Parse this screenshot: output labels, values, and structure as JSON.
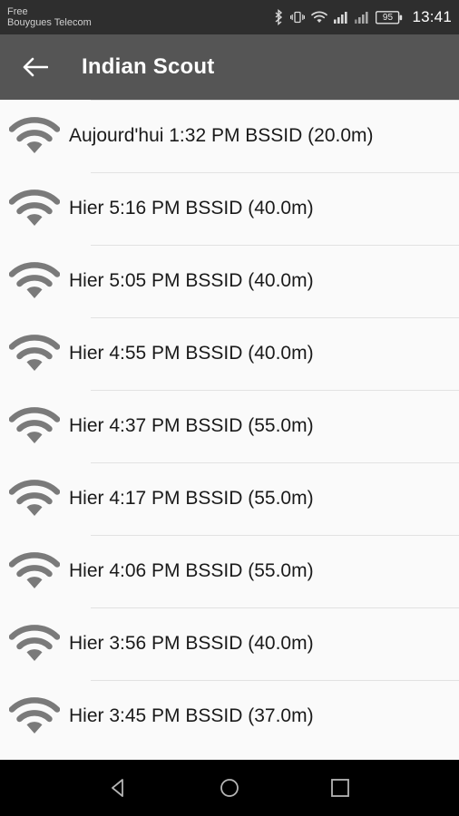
{
  "status_bar": {
    "carriers": [
      "Free",
      "Bouygues Telecom"
    ],
    "icons": [
      "bluetooth-icon",
      "vibrate-icon",
      "wifi-icon",
      "signal-1-icon",
      "signal-2-icon",
      "battery-icon"
    ],
    "battery_level": "95",
    "clock": "13:41"
  },
  "toolbar": {
    "back_icon": "back-arrow-icon",
    "title": "Indian Scout"
  },
  "list": {
    "items": [
      {
        "icon": "wifi-icon",
        "label": "Aujourd'hui 1:32 PM BSSID (20.0m)"
      },
      {
        "icon": "wifi-icon",
        "label": "Hier 5:16 PM BSSID (40.0m)"
      },
      {
        "icon": "wifi-icon",
        "label": "Hier 5:05 PM BSSID (40.0m)"
      },
      {
        "icon": "wifi-icon",
        "label": "Hier 4:55 PM BSSID (40.0m)"
      },
      {
        "icon": "wifi-icon",
        "label": "Hier 4:37 PM BSSID (55.0m)"
      },
      {
        "icon": "wifi-icon",
        "label": "Hier 4:17 PM BSSID (55.0m)"
      },
      {
        "icon": "wifi-icon",
        "label": "Hier 4:06 PM BSSID (55.0m)"
      },
      {
        "icon": "wifi-icon",
        "label": "Hier 3:56 PM BSSID (40.0m)"
      },
      {
        "icon": "wifi-icon",
        "label": "Hier 3:45 PM BSSID (37.0m)"
      }
    ]
  },
  "nav_bar": {
    "back": "nav-back-icon",
    "home": "nav-home-icon",
    "recents": "nav-recents-icon"
  },
  "colors": {
    "status_bar_bg": "#2e2e2e",
    "toolbar_bg": "#555555",
    "page_bg": "#fafafa",
    "wifi_icon": "#7a7a7a",
    "divider": "#e2e2e2",
    "nav_bar_bg": "#000000"
  }
}
